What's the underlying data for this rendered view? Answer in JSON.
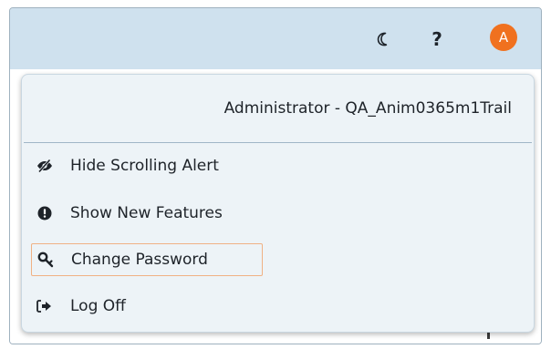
{
  "topbar": {
    "theme_icon": "moon-icon",
    "help_label": "?",
    "avatar_initial": "A"
  },
  "colors": {
    "avatar_bg": "#f0711f",
    "topbar_bg": "#cfe1ee",
    "menu_bg": "#edf3f7",
    "highlight_border": "#f0b184",
    "divider": "#9fb5c7"
  },
  "user_menu": {
    "header": "Administrator - QA_Anim0365m1Trail",
    "items": [
      {
        "label": "Hide Scrolling Alert",
        "icon": "eye-slash-icon"
      },
      {
        "label": "Show New Features",
        "icon": "exclamation-circle-icon"
      },
      {
        "label": "Change Password",
        "icon": "key-icon"
      },
      {
        "label": "Log Off",
        "icon": "sign-out-icon"
      }
    ]
  }
}
